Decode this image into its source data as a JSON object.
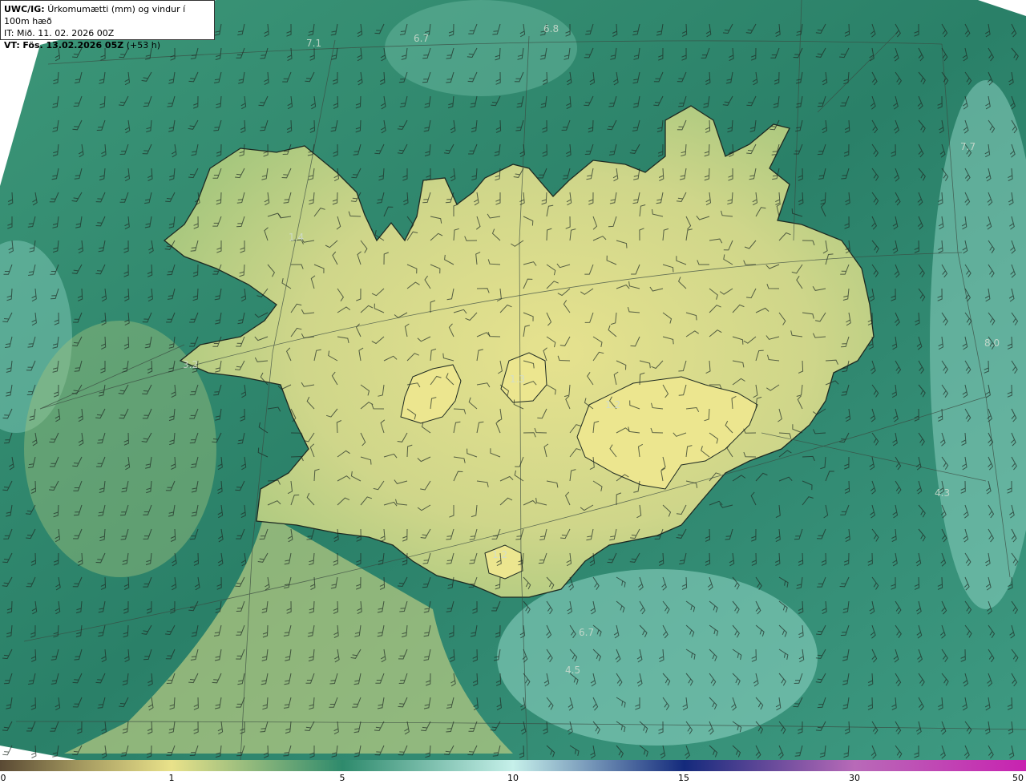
{
  "header": {
    "model_label": "UWC/IG:",
    "title": "Úrkomumætti (mm) og vindur í 100m hæð",
    "it_label": "IT:",
    "it_value": "Mið. 11. 02. 2026 00Z",
    "vt_label": "VT:",
    "vt_value": "Fös. 13.02.2026 05Z",
    "lead": "(+53 h)"
  },
  "colorbar": {
    "ticks": [
      "0",
      "1",
      "5",
      "10",
      "15",
      "30",
      "50"
    ],
    "stops": [
      "#5a4a34",
      "#a59a60",
      "#e9e28a",
      "#2e8a6c",
      "#c6f0ea",
      "#142a7c",
      "#b86ab8",
      "#c822b0"
    ]
  },
  "map_values": [
    "7.1",
    "6.7",
    "6.8",
    "7.7",
    "1.4",
    "3.2",
    "1.3",
    "1.2",
    "8.0",
    "4.3",
    "4.5",
    "6.7",
    "1.2"
  ],
  "colors": {
    "sea_dark": "#237a64",
    "sea_mid": "#3c9678",
    "sea_light": "#8ad0c0",
    "land_mid": "#a7c77e",
    "land_light": "#e6e28e"
  }
}
